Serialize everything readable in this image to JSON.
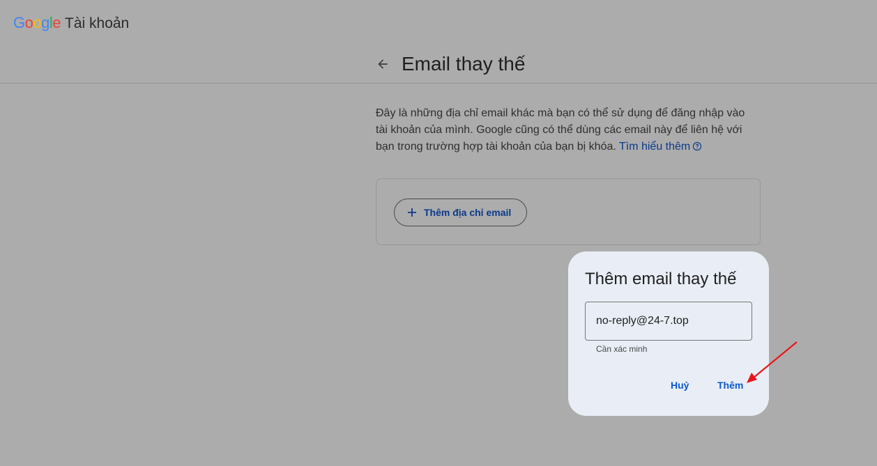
{
  "header": {
    "logo_letters": [
      {
        "ch": "G",
        "color": "#4285F4"
      },
      {
        "ch": "o",
        "color": "#EA4335"
      },
      {
        "ch": "o",
        "color": "#FBBC05"
      },
      {
        "ch": "g",
        "color": "#4285F4"
      },
      {
        "ch": "l",
        "color": "#34A853"
      },
      {
        "ch": "e",
        "color": "#EA4335"
      }
    ],
    "product": "Tài khoản"
  },
  "page": {
    "back_icon": "arrow-back-icon",
    "title": "Email thay thế",
    "description": "Đây là những địa chỉ email khác mà bạn có thể sử dụng để đăng nhập vào tài khoản của mình. Google cũng có thể dùng các email này để liên hệ với bạn trong trường hợp tài khoản của bạn bị khóa.",
    "learn_more": "Tìm hiểu thêm",
    "help_icon": "help-circle-icon"
  },
  "card": {
    "add_email_label": "Thêm địa chỉ email",
    "add_icon": "plus-icon"
  },
  "dialog": {
    "title": "Thêm email thay thế",
    "email_value": "no-reply@24-7.top",
    "helper": "Cần xác minh",
    "cancel_label": "Huỷ",
    "confirm_label": "Thêm"
  },
  "colors": {
    "overlay_background": "#acacac",
    "dialog_background": "#e9eef6",
    "primary": "#0b57d0",
    "annotation_arrow": "#e8161b"
  }
}
